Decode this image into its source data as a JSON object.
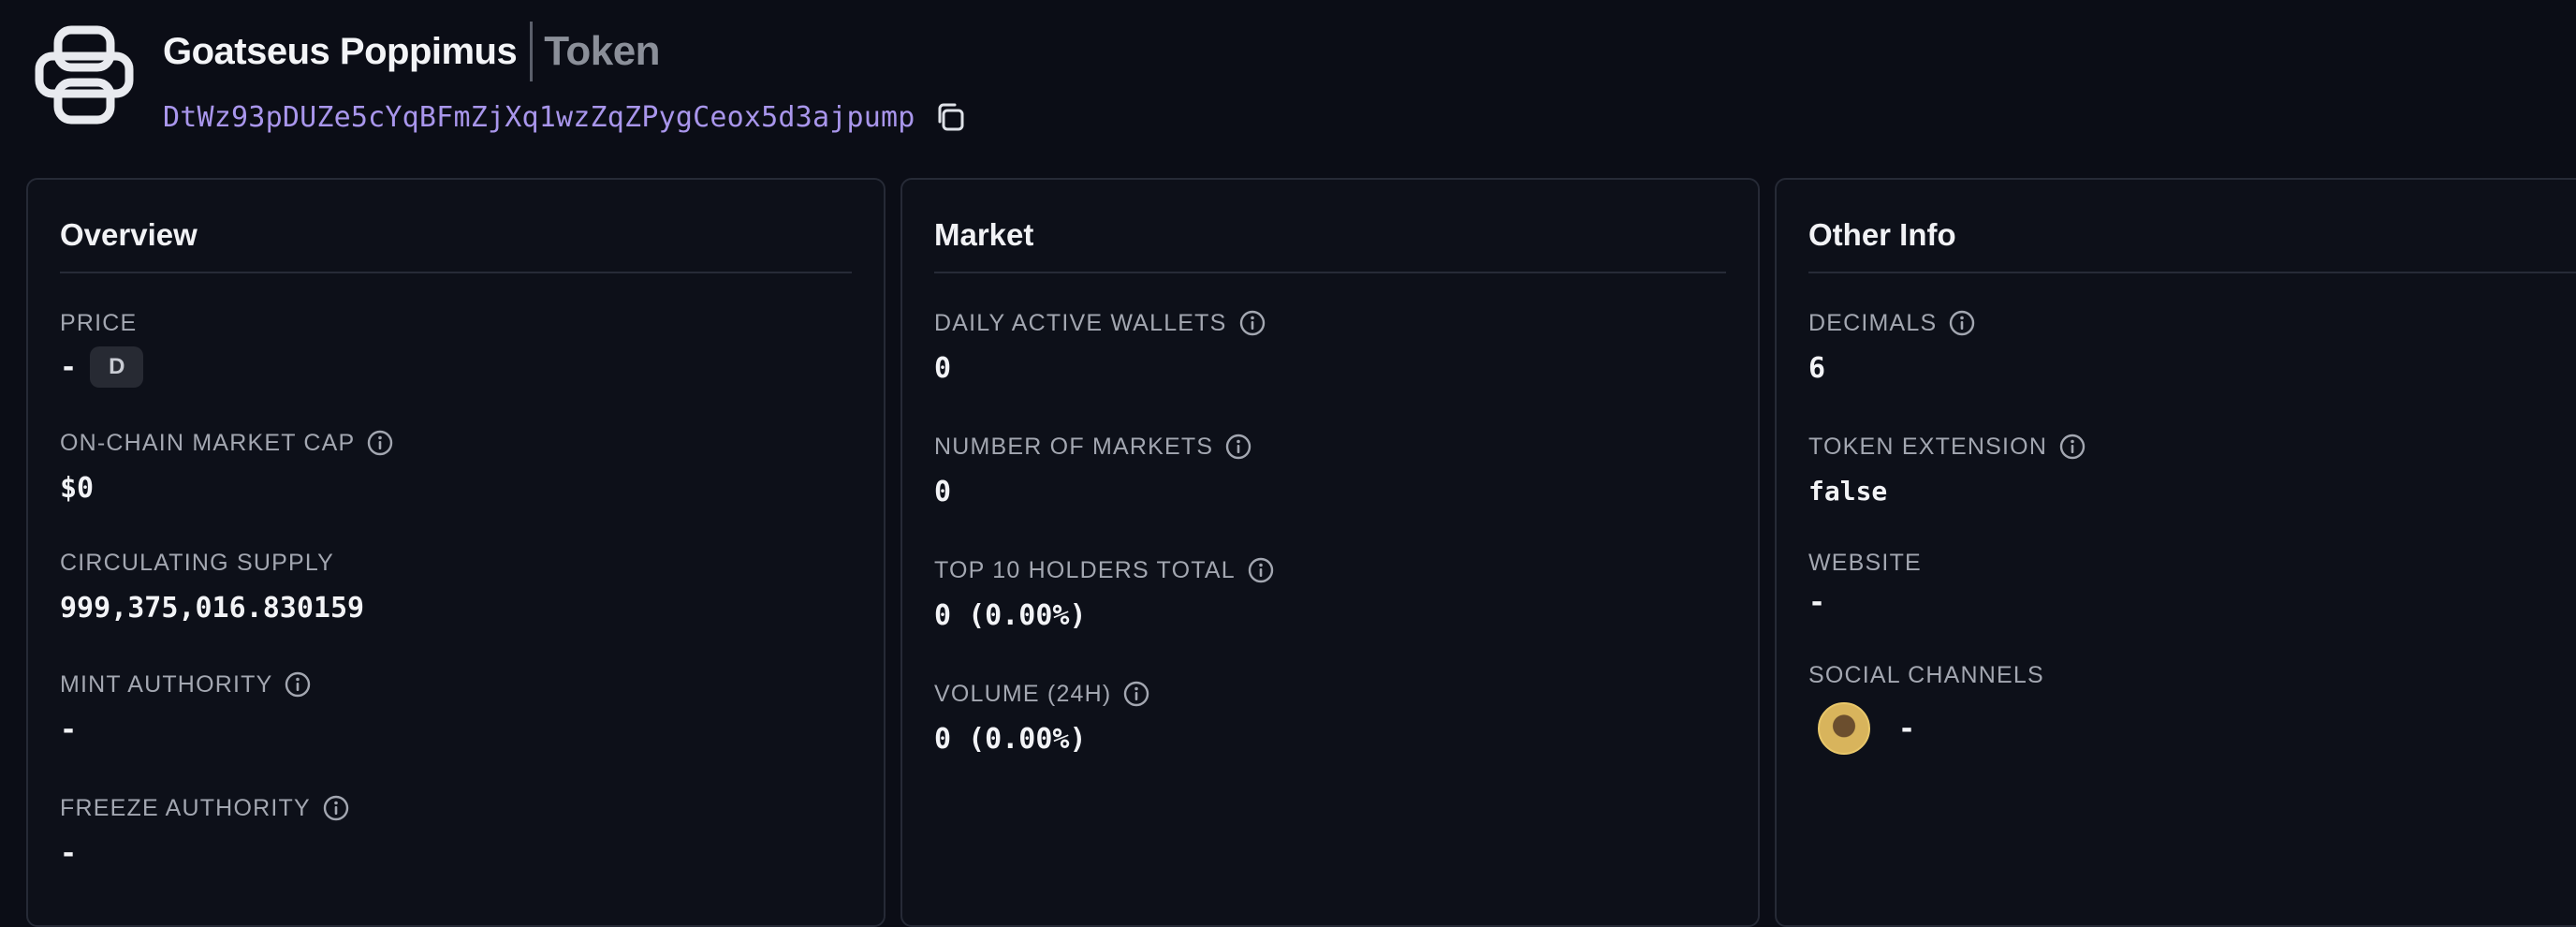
{
  "token": {
    "name": "Goatseus Poppimus",
    "type_label": "Token",
    "address": "DtWz93pDUZe5cYqBFmZjXq1wzZqZPygCeox5d3ajpump"
  },
  "overview": {
    "title": "Overview",
    "price": {
      "label": "PRICE",
      "value": "-",
      "badge": "D"
    },
    "market_cap": {
      "label": "ON-CHAIN MARKET CAP",
      "value": "$0"
    },
    "circulating_supply": {
      "label": "CIRCULATING SUPPLY",
      "value": "999,375,016.830159"
    },
    "mint_authority": {
      "label": "MINT AUTHORITY",
      "value": "-"
    },
    "freeze_authority": {
      "label": "FREEZE AUTHORITY",
      "value": "-"
    }
  },
  "market": {
    "title": "Market",
    "daily_active_wallets": {
      "label": "DAILY ACTIVE WALLETS",
      "value": "0"
    },
    "number_of_markets": {
      "label": "NUMBER OF MARKETS",
      "value": "0"
    },
    "top10_holders": {
      "label": "TOP 10 HOLDERS TOTAL",
      "value": "0 (0.00%)"
    },
    "volume_24h": {
      "label": "VOLUME (24H)",
      "value": "0 (0.00%)"
    }
  },
  "other_info": {
    "title": "Other Info",
    "decimals": {
      "label": "DECIMALS",
      "value": "6"
    },
    "token_extension": {
      "label": "TOKEN EXTENSION",
      "value": "false"
    },
    "website": {
      "label": "WEBSITE",
      "value": "-"
    },
    "social_channels": {
      "label": "SOCIAL CHANNELS",
      "value": "-"
    }
  },
  "colors": {
    "background": "#0b0d16",
    "card_border": "#262a36",
    "address": "#a996ec",
    "label": "#a3a7b1"
  },
  "icons": [
    "token-logo-icon",
    "copy-icon",
    "info-icon",
    "social-avatar-icon"
  ]
}
